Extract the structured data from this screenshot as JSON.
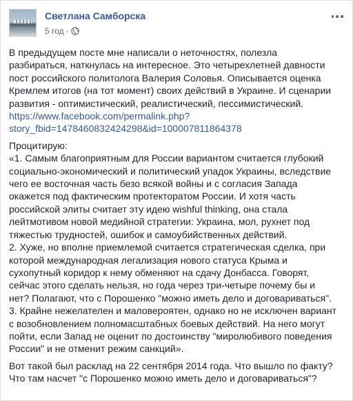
{
  "post": {
    "author": "Светлана Самборска",
    "time": "5 год",
    "separator": "·",
    "privacy_icon": "globe-icon",
    "menu_icon": "more-icon",
    "paragraph1": [
      "В предыдущем посте мне написали о неточностях, полезла",
      "разбираться, наткнулась на интересное. Это четырехлетней давности",
      "пост российского политолога Валерия Соловья. Описывается оценка",
      "Кремлем итогов (на тот момент) своих действий в Украине. И сценарии",
      "развития - оптимистический, реалистический, пессимистический."
    ],
    "link": [
      "https://www.facebook.com/permalink.php?",
      "story_fbid=1478460832424298&id=100007811864378"
    ],
    "paragraph2": [
      "Процитирую:",
      "«1. Самым благоприятным для России вариантом считается глубокий",
      "социально-экономический и политический упадок Украины, вследствие",
      "чего ее восточная часть безо всякой войны и с согласия Запада",
      "окажется под фактическим протекторатом России. И хотя часть",
      "российской элиты считает эту идею wishful thinking, она стала",
      "лейтмотивом новой медийной стратегии: Украина, мол, рухнет под",
      "тяжестью трудностей, ошибок и самоубийственных действий.",
      "2. Хуже, но вполне приемлемой считается стратегическая сделка, при",
      "которой международная легализация нового статуса Крыма и",
      "сухопутный коридор к нему обменяют на сдачу Донбасса. Говорят,",
      "сейчас этого сделать нельзя, но года через три-четыре почему бы и",
      "нет? Полагают, что с Порошенко \"можно иметь дело и договариваться\".",
      "3. Крайне нежелателен и маловероятен, однако но не исключен вариант",
      "с возобновлением полномасштабных боевых действий. На него могут",
      "пойти, если Запад не оценит по достоинству \"миролюбивого поведения",
      "России\" и не отменит режим санкций»."
    ],
    "paragraph3": [
      "Вот такой был расклад на 22 сентября 2014 года. Что вышло по факту?",
      "Что там насчет \"с Порошенко можно иметь дело и договариваться\"?"
    ],
    "colors": {
      "author": "#385898",
      "link": "#365899",
      "text": "#1d2129",
      "meta": "#616770"
    }
  }
}
